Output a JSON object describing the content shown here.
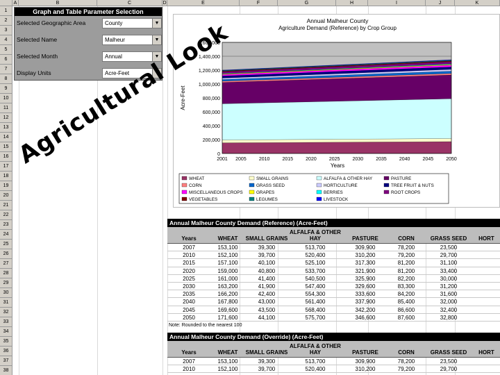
{
  "columns": [
    "A",
    "B",
    "C",
    "D",
    "E",
    "F",
    "G",
    "H",
    "I",
    "J",
    "K"
  ],
  "rows": [
    "1",
    "2",
    "3",
    "4",
    "5",
    "6",
    "7",
    "8",
    "9",
    "10",
    "11",
    "12",
    "13",
    "14",
    "15",
    "16",
    "17",
    "18",
    "19",
    "20",
    "21",
    "22",
    "23",
    "24",
    "25",
    "26",
    "27",
    "28",
    "29",
    "30",
    "31",
    "32",
    "33",
    "34",
    "35",
    "36",
    "37",
    "38"
  ],
  "param_panel": {
    "title": "Graph and Table Parameter Selection",
    "fields": [
      {
        "label": "Selected Geographic Area",
        "value": "County"
      },
      {
        "label": "Selected Name",
        "value": "Malheur"
      },
      {
        "label": "Selected Month",
        "value": "Annual"
      },
      {
        "label": "Display Units",
        "value": "Acre-Feet"
      }
    ]
  },
  "overlay_text": "Agricultural Look",
  "chart_data": {
    "type": "area",
    "title": "Annual Malheur County",
    "subtitle": "Agriculture Demand (Reference) by Crop Group",
    "xlabel": "Years",
    "ylabel": "Acre-Feet",
    "x": [
      2001,
      2005,
      2010,
      2015,
      2020,
      2025,
      2030,
      2035,
      2040,
      2045,
      2050
    ],
    "ylim": [
      0,
      1600000
    ],
    "yticks": [
      "0",
      "200,000",
      "400,000",
      "600,000",
      "800,000",
      "1,000,000",
      "1,200,000",
      "1,400,000",
      "1,600,000"
    ],
    "series": [
      {
        "name": "WHEAT",
        "color": "#993366",
        "start": 150000,
        "end": 170000
      },
      {
        "name": "SMALL GRAINS",
        "color": "#ffffcc",
        "start": 40000,
        "end": 44000
      },
      {
        "name": "ALFALFA & OTHER HAY",
        "color": "#ccffff",
        "start": 510000,
        "end": 570000
      },
      {
        "name": "PASTURE",
        "color": "#660066",
        "start": 300000,
        "end": 340000
      },
      {
        "name": "CORN",
        "color": "#ff8080",
        "start": 18000,
        "end": 22000
      },
      {
        "name": "GRASS SEED",
        "color": "#0066cc",
        "start": 23000,
        "end": 32000
      },
      {
        "name": "HORTICULTURE",
        "color": "#ccccff",
        "start": 20000,
        "end": 26000
      },
      {
        "name": "TREE FRUIT & NUTS",
        "color": "#000080",
        "start": 30000,
        "end": 35000
      },
      {
        "name": "MISCELLANEOUS CROPS",
        "color": "#ff00ff",
        "start": 20000,
        "end": 26000
      },
      {
        "name": "GRAPES",
        "color": "#ffff00",
        "start": 8000,
        "end": 10000
      },
      {
        "name": "BERRIES",
        "color": "#00ffff",
        "start": 6000,
        "end": 8000
      },
      {
        "name": "ROOT CROPS",
        "color": "#800080",
        "start": 25000,
        "end": 30000
      },
      {
        "name": "VEGETABLES",
        "color": "#800000",
        "start": 10000,
        "end": 13000
      },
      {
        "name": "LEGUMES",
        "color": "#008080",
        "start": 8000,
        "end": 10000
      },
      {
        "name": "LIVESTOCK",
        "color": "#0000ff",
        "start": 5000,
        "end": 6000
      }
    ],
    "total_start": 1200000,
    "total_end": 1350000,
    "legend_position": "bottom"
  },
  "table_reference": {
    "title": "Annual Malheur County Demand (Reference) (Acre-Feet)",
    "headers": [
      "Years",
      "WHEAT",
      "SMALL GRAINS",
      "ALFALFA & OTHER HAY",
      "PASTURE",
      "CORN",
      "GRASS SEED",
      "HORT"
    ],
    "rows": [
      [
        "2007",
        "153,100",
        "39,300",
        "513,700",
        "309,900",
        "78,200",
        "23,500",
        ""
      ],
      [
        "2010",
        "152,100",
        "39,700",
        "520,400",
        "310,200",
        "79,200",
        "29,700",
        ""
      ],
      [
        "2015",
        "157,100",
        "40,100",
        "525,100",
        "317,300",
        "81,200",
        "31,100",
        ""
      ],
      [
        "2020",
        "159,000",
        "40,800",
        "533,700",
        "321,900",
        "81,200",
        "33,400",
        ""
      ],
      [
        "2025",
        "161,000",
        "41,400",
        "540,500",
        "325,900",
        "82,200",
        "30,000",
        ""
      ],
      [
        "2030",
        "163,200",
        "41,900",
        "547,400",
        "329,600",
        "83,300",
        "31,200",
        ""
      ],
      [
        "2035",
        "166,200",
        "42,400",
        "554,300",
        "333,600",
        "84,200",
        "31,600",
        ""
      ],
      [
        "2040",
        "167,800",
        "43,000",
        "561,400",
        "337,900",
        "85,400",
        "32,000",
        ""
      ],
      [
        "2045",
        "169,600",
        "43,500",
        "568,400",
        "342,200",
        "86,600",
        "32,400",
        ""
      ],
      [
        "2050",
        "171,600",
        "44,100",
        "575,700",
        "346,600",
        "87,600",
        "32,800",
        ""
      ]
    ],
    "note": "Note: Rounded to the nearest 100"
  },
  "table_override": {
    "title": "Annual Malheur County Demand (Override) (Acre-Feet)",
    "headers": [
      "Years",
      "WHEAT",
      "SMALL GRAINS",
      "ALFALFA & OTHER HAY",
      "PASTURE",
      "CORN",
      "GRASS SEED",
      "HORT"
    ],
    "rows": [
      [
        "2007",
        "153,100",
        "39,300",
        "513,700",
        "309,900",
        "78,200",
        "23,500",
        ""
      ],
      [
        "2010",
        "152,100",
        "39,700",
        "520,400",
        "310,200",
        "79,200",
        "29,700",
        ""
      ]
    ]
  }
}
